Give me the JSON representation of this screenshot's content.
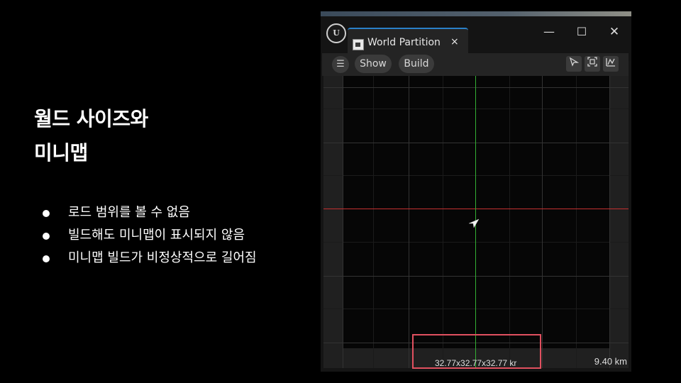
{
  "slide": {
    "title_line1": "월드 사이즈와",
    "title_line2": "미니맵",
    "bullets": [
      "로드 범위를 볼 수 없음",
      "빌드해도 미니맵이 표시되지 않음",
      "미니맵 빌드가 비정상적으로 길어짐"
    ]
  },
  "window": {
    "logo": "U",
    "tab_label": "World Partition",
    "tab_icon": "world-partition-icon",
    "close_glyph": "×",
    "controls": {
      "minimize": "—",
      "maximize": "☐",
      "close": "✕"
    }
  },
  "toolbar": {
    "menu_glyph": "☰",
    "show_label": "Show",
    "build_label": "Build",
    "icons": [
      "select-icon",
      "focus-icon",
      "chart-icon"
    ]
  },
  "map": {
    "x_axis_color": "#c43030",
    "y_axis_color": "#33b033",
    "readout": "32.77x32.77x32.77 kr",
    "scale": "9.40 km",
    "highlight_color": "#e0505f"
  }
}
